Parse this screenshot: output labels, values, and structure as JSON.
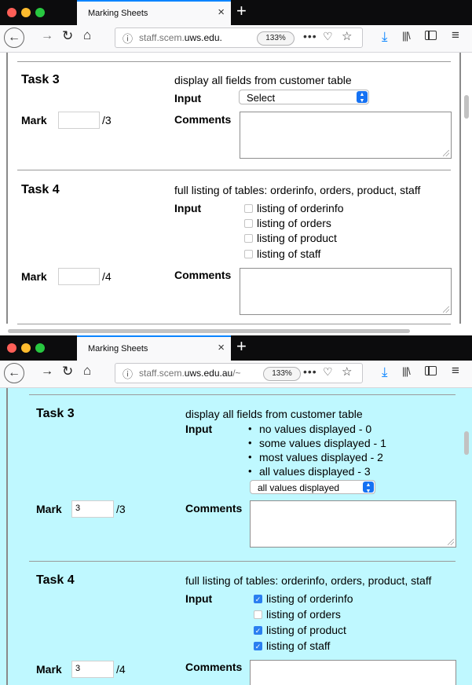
{
  "browser": {
    "tab_title": "Marking Sheets",
    "url_host_1": "staff.scem.",
    "url_domain_1": "uws.edu.",
    "url_host_2": "staff.scem.",
    "url_domain_2": "uws.edu.au",
    "url_tail_2": "/~",
    "zoom": "133%"
  },
  "first": {
    "task3": {
      "title": "Task 3",
      "description": "display all fields from customer table",
      "input_label": "Input",
      "select_value": "Select",
      "mark_label": "Mark",
      "mark_value": "",
      "mark_max": "/3",
      "comments_label": "Comments"
    },
    "task4": {
      "title": "Task 4",
      "description": "full listing of tables: orderinfo, orders, product, staff",
      "input_label": "Input",
      "checkboxes": [
        {
          "label": "listing of orderinfo",
          "checked": false
        },
        {
          "label": "listing of orders",
          "checked": false
        },
        {
          "label": "listing of product",
          "checked": false
        },
        {
          "label": "listing of staff",
          "checked": false
        }
      ],
      "mark_label": "Mark",
      "mark_value": "",
      "mark_max": "/4",
      "comments_label": "Comments"
    }
  },
  "second": {
    "background": "#bff8ff",
    "task3": {
      "title": "Task 3",
      "description": "display all fields from customer table",
      "input_label": "Input",
      "options": [
        "no values displayed - 0",
        "some values displayed - 1",
        "most values displayed - 2",
        "all values displayed - 3"
      ],
      "select_value": "all values displayed",
      "mark_label": "Mark",
      "mark_value": "3",
      "mark_max": "/3",
      "comments_label": "Comments"
    },
    "task4": {
      "title": "Task 4",
      "description": "full listing of tables: orderinfo, orders, product, staff",
      "input_label": "Input",
      "checkboxes": [
        {
          "label": "listing of orderinfo",
          "checked": true
        },
        {
          "label": "listing of orders",
          "checked": false
        },
        {
          "label": "listing of product",
          "checked": true
        },
        {
          "label": "listing of staff",
          "checked": true
        }
      ],
      "mark_label": "Mark",
      "mark_value": "3",
      "mark_max": "/4",
      "comments_label": "Comments"
    }
  }
}
